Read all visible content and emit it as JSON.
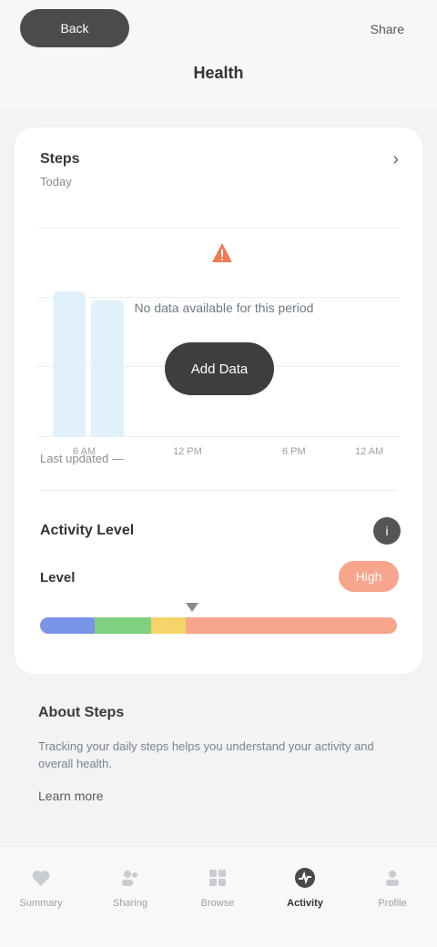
{
  "topbar": {
    "back_label": "Back",
    "right_label": "Share",
    "title": "Health"
  },
  "card": {
    "title": "Steps",
    "subtitle": "Today",
    "chevron": "›",
    "no_data_text": "No data available for this period",
    "button_label": "Add Data",
    "footnote": "Last updated —",
    "x_labels": [
      "6 AM",
      "12 PM",
      "6 PM",
      "12 AM"
    ]
  },
  "activity": {
    "title": "Activity Level",
    "info_icon": "i",
    "level_label": "Level",
    "badge_label": "High",
    "scale_colors": [
      "#7a95e8",
      "#7fd07f",
      "#f5d56a",
      "#f7a58d"
    ]
  },
  "info": {
    "title": "About Steps",
    "body": "Tracking your daily steps helps you understand your activity and overall health.",
    "link": "Learn more"
  },
  "nav": [
    {
      "label": "Summary",
      "icon": "heart-icon"
    },
    {
      "label": "Sharing",
      "icon": "people-icon"
    },
    {
      "label": "Browse",
      "icon": "grid-icon"
    },
    {
      "label": "Activity",
      "icon": "activity-icon"
    },
    {
      "label": "Profile",
      "icon": "profile-icon"
    }
  ]
}
